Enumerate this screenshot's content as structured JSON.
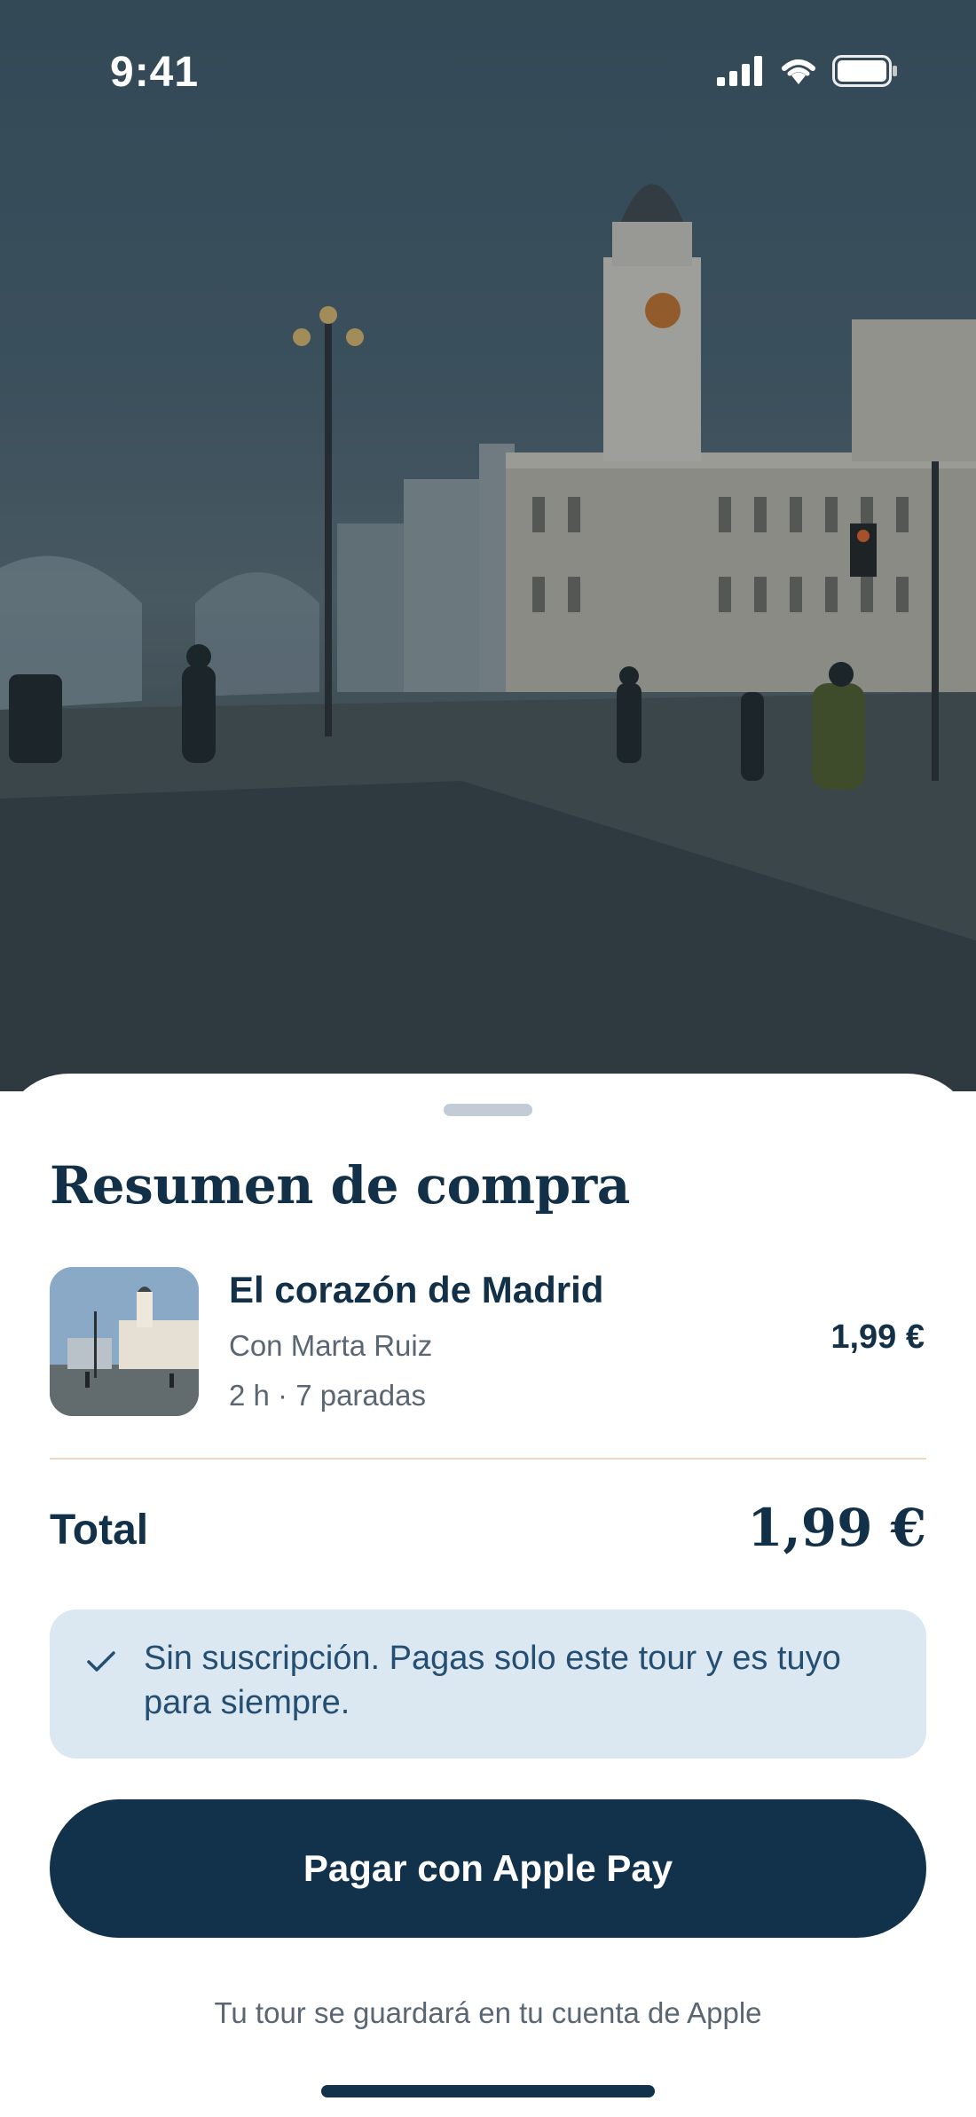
{
  "status_bar": {
    "time": "9:41",
    "icons": [
      "cellular-signal-icon",
      "wifi-icon",
      "battery-icon"
    ]
  },
  "hero": {
    "image": "plaza-building-photo"
  },
  "sheet": {
    "title": "Resumen de compra",
    "item": {
      "name": "El corazón de Madrid",
      "guide": "Con Marta Ruiz",
      "meta": "2 h · 7 paradas",
      "price": "1,99 €"
    },
    "total": {
      "label": "Total",
      "value": "1,99 €"
    },
    "notice": {
      "icon": "check-icon",
      "text": "Sin suscripción. Pagas solo este tour y es tuyo para siempre."
    },
    "pay_button_label": "Pagar con Apple Pay",
    "footer_note": "Tu tour se guardará en tu cuenta de Apple"
  },
  "colors": {
    "primary": "#12324b",
    "notice_bg": "#dbe7f1",
    "notice_text": "#244f72",
    "divider": "#ead9bd",
    "muted_text": "#5b6673"
  }
}
